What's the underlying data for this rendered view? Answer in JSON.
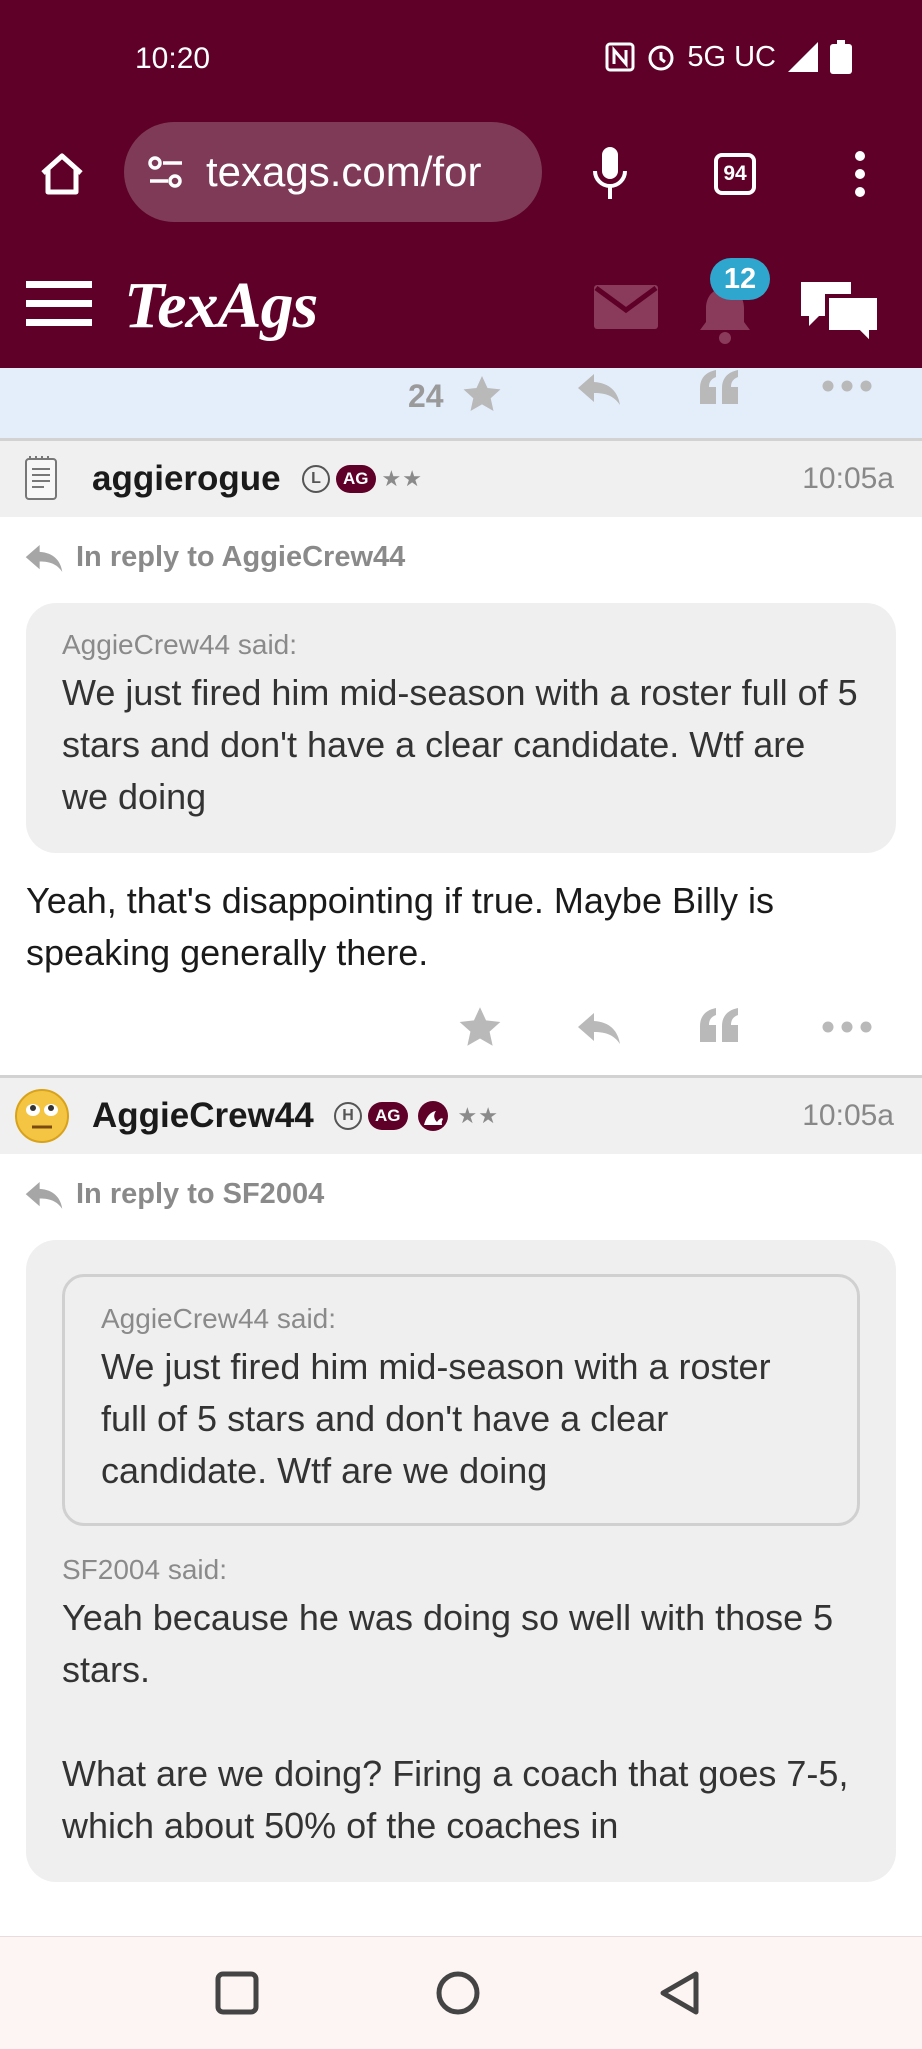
{
  "status_bar": {
    "time": "10:20",
    "network": "5G UC"
  },
  "browser": {
    "url": "texags.com/for",
    "tab_count": "94"
  },
  "site": {
    "logo": "TexAgs",
    "notification_count": "12",
    "colors": {
      "brand": "#5e0027",
      "badge": "#2fa6cd"
    }
  },
  "previous_post": {
    "star_count": "24"
  },
  "posts": [
    {
      "username": "aggierogue",
      "badge_letter": "L",
      "badge_ag": "AG",
      "stars": "★★",
      "time": "10:05a",
      "reply_to": "In reply to AggieCrew44",
      "quote": {
        "said": "AggieCrew44 said:",
        "text": "We just fired him mid-season with a roster full of 5 stars and don't have a clear candidate. Wtf are we doing"
      },
      "body": "Yeah, that's disappointing if true. Maybe Billy is speaking generally there."
    },
    {
      "username": "AggieCrew44",
      "badge_letter": "H",
      "badge_ag": "AG",
      "stars": "★★",
      "time": "10:05a",
      "reply_to": "In reply to SF2004",
      "inner_quote": {
        "said": "AggieCrew44 said:",
        "text": "We just fired him mid-season with a roster full of 5 stars and don't have a clear candidate. Wtf are we doing"
      },
      "quote": {
        "said": "SF2004 said:",
        "text_1": "Yeah because he was doing so well with those 5 stars.",
        "text_2": "What are we doing? Firing a coach that goes 7-5, which about 50% of the coaches in"
      }
    }
  ]
}
